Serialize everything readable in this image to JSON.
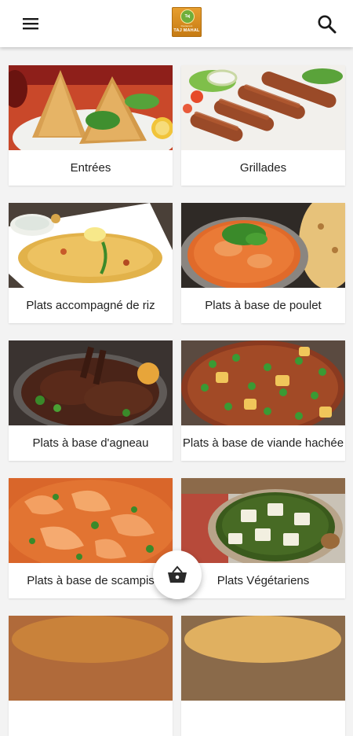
{
  "app": {
    "logo_badge": "Taj",
    "logo_small": "Restaurant",
    "logo_name": "TAJ MAHAL",
    "icons": {
      "menu": "hamburger-menu-icon",
      "search": "search-icon",
      "cart": "basket-icon"
    }
  },
  "categories": [
    {
      "label": "Entrées",
      "image": "samosa"
    },
    {
      "label": "Grillades",
      "image": "seekh-kebab"
    },
    {
      "label": "Plats accompagné de riz",
      "image": "biryani"
    },
    {
      "label": "Plats à base de poulet",
      "image": "chicken-curry"
    },
    {
      "label": "Plats à base d'agneau",
      "image": "lamb-chops"
    },
    {
      "label": "Plats à base de viande hachée",
      "image": "keema"
    },
    {
      "label": "Plats à base de scampis",
      "image": "shrimp-curry"
    },
    {
      "label": "Plats Végétariens",
      "image": "palak-paneer"
    }
  ],
  "colors": {
    "background": "#f3f3f3",
    "appbar": "#ffffff",
    "logo": "#d88a1f"
  }
}
